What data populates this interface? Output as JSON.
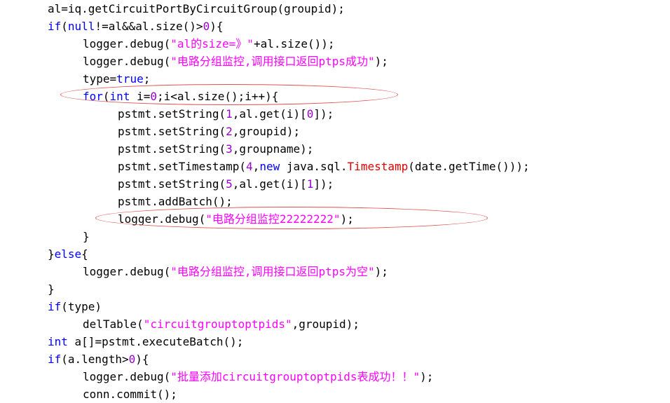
{
  "code_lines": [
    {
      "indent": 0,
      "tokens": [
        {
          "t": "al=iq.getCircuitPortByCircuitGroup(groupid);",
          "c": ""
        }
      ]
    },
    {
      "indent": 0,
      "tokens": [
        {
          "t": "if",
          "c": "kw"
        },
        {
          "t": "(",
          "c": ""
        },
        {
          "t": "null",
          "c": "kw"
        },
        {
          "t": "!=al&&al.size()>",
          "c": ""
        },
        {
          "t": "0",
          "c": "num"
        },
        {
          "t": "){",
          "c": ""
        }
      ]
    },
    {
      "indent": 1,
      "tokens": [
        {
          "t": "logger.debug(",
          "c": ""
        },
        {
          "t": "\"al的size=》\"",
          "c": "str"
        },
        {
          "t": "+al.size());",
          "c": ""
        }
      ]
    },
    {
      "indent": 1,
      "tokens": [
        {
          "t": "logger.debug(",
          "c": ""
        },
        {
          "t": "\"电路分组监控,调用接口返回ptps成功\"",
          "c": "str"
        },
        {
          "t": ");",
          "c": ""
        }
      ]
    },
    {
      "indent": 1,
      "tokens": [
        {
          "t": "type=",
          "c": ""
        },
        {
          "t": "true",
          "c": "kw"
        },
        {
          "t": ";",
          "c": ""
        }
      ]
    },
    {
      "indent": 1,
      "tokens": [
        {
          "t": "for",
          "c": "kw"
        },
        {
          "t": "(",
          "c": ""
        },
        {
          "t": "int",
          "c": "kw"
        },
        {
          "t": " i=",
          "c": ""
        },
        {
          "t": "0",
          "c": "num"
        },
        {
          "t": ";i<al.size();i++){",
          "c": ""
        }
      ]
    },
    {
      "indent": 2,
      "tokens": [
        {
          "t": "pstmt.setString(",
          "c": ""
        },
        {
          "t": "1",
          "c": "num"
        },
        {
          "t": ",al.get(i)[",
          "c": ""
        },
        {
          "t": "0",
          "c": "num"
        },
        {
          "t": "]);",
          "c": ""
        }
      ]
    },
    {
      "indent": 2,
      "tokens": [
        {
          "t": "pstmt.setString(",
          "c": ""
        },
        {
          "t": "2",
          "c": "num"
        },
        {
          "t": ",groupid);",
          "c": ""
        }
      ]
    },
    {
      "indent": 2,
      "tokens": [
        {
          "t": "pstmt.setString(",
          "c": ""
        },
        {
          "t": "3",
          "c": "num"
        },
        {
          "t": ",groupname);",
          "c": ""
        }
      ]
    },
    {
      "indent": 2,
      "tokens": [
        {
          "t": "pstmt.setTimestamp(",
          "c": ""
        },
        {
          "t": "4",
          "c": "num"
        },
        {
          "t": ",",
          "c": ""
        },
        {
          "t": "new",
          "c": "kw"
        },
        {
          "t": " java.sql.",
          "c": ""
        },
        {
          "t": "Timestamp",
          "c": "cls"
        },
        {
          "t": "(date.getTime()));",
          "c": ""
        }
      ]
    },
    {
      "indent": 2,
      "tokens": [
        {
          "t": "pstmt.setString(",
          "c": ""
        },
        {
          "t": "5",
          "c": "num"
        },
        {
          "t": ",al.get(i)[",
          "c": ""
        },
        {
          "t": "1",
          "c": "num"
        },
        {
          "t": "]);",
          "c": ""
        }
      ]
    },
    {
      "indent": 2,
      "tokens": [
        {
          "t": "pstmt.addBatch();",
          "c": ""
        }
      ]
    },
    {
      "indent": 2,
      "tokens": [
        {
          "t": "logger.debug(",
          "c": ""
        },
        {
          "t": "\"电路分组监控22222222\"",
          "c": "str"
        },
        {
          "t": ");",
          "c": ""
        }
      ]
    },
    {
      "indent": 1,
      "tokens": [
        {
          "t": "}",
          "c": ""
        }
      ]
    },
    {
      "indent": 0,
      "tokens": [
        {
          "t": "}",
          "c": ""
        },
        {
          "t": "else",
          "c": "kw"
        },
        {
          "t": "{",
          "c": ""
        }
      ]
    },
    {
      "indent": 1,
      "tokens": [
        {
          "t": "logger.debug(",
          "c": ""
        },
        {
          "t": "\"电路分组监控,调用接口返回ptps为空\"",
          "c": "str"
        },
        {
          "t": ");",
          "c": ""
        }
      ]
    },
    {
      "indent": 0,
      "tokens": [
        {
          "t": "}",
          "c": ""
        }
      ]
    },
    {
      "indent": 0,
      "tokens": [
        {
          "t": "if",
          "c": "kw"
        },
        {
          "t": "(type)",
          "c": ""
        }
      ]
    },
    {
      "indent": 1,
      "tokens": [
        {
          "t": "delTable(",
          "c": ""
        },
        {
          "t": "\"circuitgrouptoptpids\"",
          "c": "str"
        },
        {
          "t": ",groupid);",
          "c": ""
        }
      ]
    },
    {
      "indent": 0,
      "tokens": [
        {
          "t": "int",
          "c": "kw"
        },
        {
          "t": " a[]=pstmt.executeBatch();",
          "c": ""
        }
      ]
    },
    {
      "indent": 0,
      "tokens": [
        {
          "t": "if",
          "c": "kw"
        },
        {
          "t": "(a.length>",
          "c": ""
        },
        {
          "t": "0",
          "c": "num"
        },
        {
          "t": "){",
          "c": ""
        }
      ]
    },
    {
      "indent": 1,
      "tokens": [
        {
          "t": "logger.debug(",
          "c": ""
        },
        {
          "t": "\"批量添加circuitgrouptoptpids表成功！！\"",
          "c": "str"
        },
        {
          "t": ");",
          "c": ""
        }
      ]
    },
    {
      "indent": 1,
      "tokens": [
        {
          "t": "conn.commit();",
          "c": ""
        }
      ]
    }
  ],
  "highlights": [
    {
      "line": 5,
      "label": "for-loop-highlight"
    },
    {
      "line": 12,
      "label": "debug-22222222-highlight"
    }
  ],
  "colors": {
    "keyword": "#0000ff",
    "string": "#ff00ff",
    "number": "#9900cc",
    "class": "#e00000",
    "text": "#000000",
    "highlight_oval": "#e05050"
  }
}
